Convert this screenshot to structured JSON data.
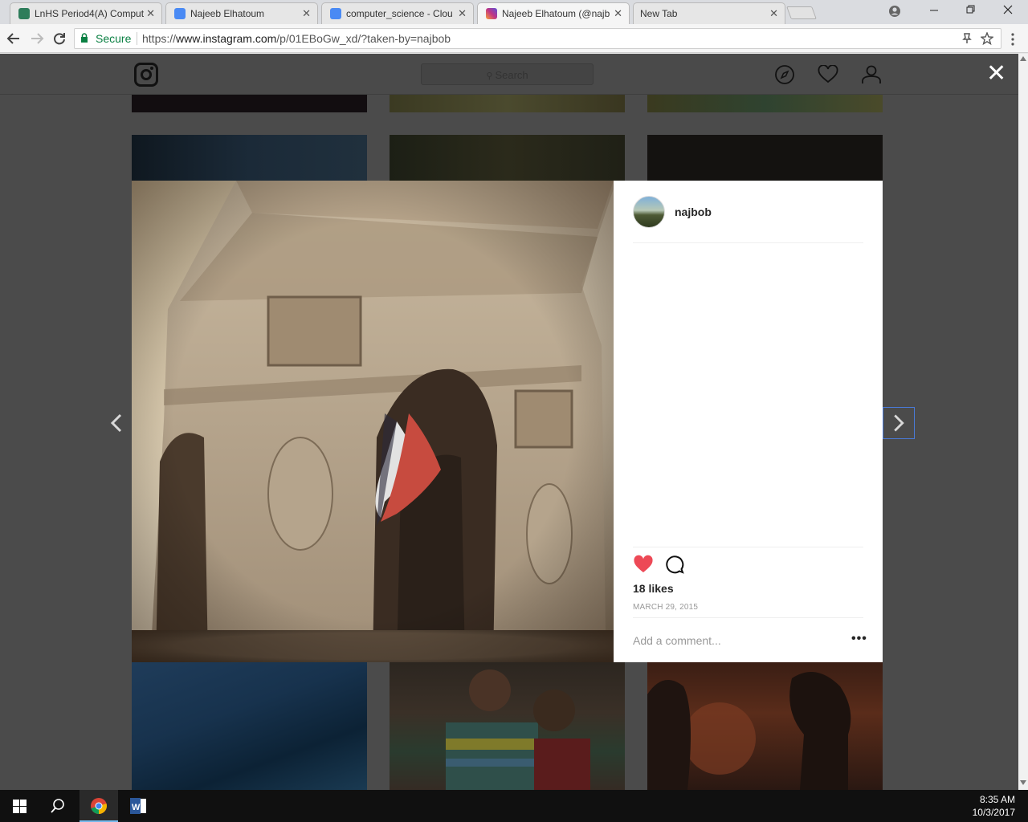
{
  "browser": {
    "tabs": [
      {
        "title": "LnHS Period4(A) Comput",
        "favicon_color": "#2e7d5b"
      },
      {
        "title": "Najeeb Elhatoum",
        "favicon_color": "#4a8af4"
      },
      {
        "title": "computer_science - Clou",
        "favicon_color": "#4a8af4"
      },
      {
        "title": "Najeeb Elhatoum (@najb",
        "favicon_color": "#c13584"
      },
      {
        "title": "New Tab",
        "favicon_color": ""
      }
    ],
    "active_tab": 3,
    "secure_label": "Secure",
    "url_scheme": "https://",
    "url_host": "www.instagram.com",
    "url_path": "/p/01EBoGw_xd/?taken-by=najbob"
  },
  "instagram": {
    "search_placeholder": "Search",
    "post": {
      "username": "najbob",
      "likes": "18 likes",
      "date": "MARCH 29, 2015",
      "add_comment_placeholder": "Add a comment...",
      "more_label": "•••",
      "liked": true,
      "heart_color": "#ed4956"
    }
  },
  "taskbar": {
    "time": "8:35 AM",
    "date": "10/3/2017"
  }
}
